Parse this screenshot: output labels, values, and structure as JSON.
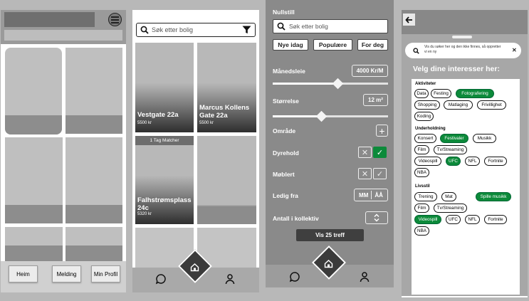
{
  "screen1": {
    "nav": {
      "home_label": "Heim",
      "messages_label": "Melding",
      "profile_label": "Min Profil"
    }
  },
  "screen2": {
    "search": {
      "placeholder": "Søk etter bolig"
    },
    "listings": [
      {
        "name": "Vestgate 22a",
        "price": "5500 kr",
        "badge": ""
      },
      {
        "name": "Marcus Kollens Gate 22a",
        "price": "5500 kr",
        "badge": ""
      },
      {
        "name": "Falhstrømsplass 24c",
        "price": "5320 kr",
        "badge": "1 Tag Matcher"
      }
    ]
  },
  "screen3": {
    "reset_label": "Nullstill",
    "search_placeholder": "Søk etter bolig",
    "quick_filters": [
      "Nye idag",
      "Populære",
      "For deg"
    ],
    "rent": {
      "label": "Månedsleie",
      "value": "4000 Kr/M",
      "fraction": 0.55
    },
    "size": {
      "label": "Størrelse",
      "value": "12 m²",
      "fraction": 0.4
    },
    "area": {
      "label": "Område"
    },
    "pets": {
      "label": "Dyrehold",
      "selected": "yes"
    },
    "furnished": {
      "label": "Møblert",
      "selected": "none"
    },
    "available": {
      "label": "Ledig fra",
      "month": "MM",
      "year": "ÅÅ"
    },
    "roommates": {
      "label": "Antall i kollektiv"
    },
    "submit_label": "Vis 25 treff"
  },
  "screen4": {
    "hint_text": "Vis du søker her og den ikke finnes, så oppretter vi en ny",
    "title": "Velg dine interesser her:",
    "categories": [
      {
        "name": "Aktiviteter",
        "tags": [
          {
            "label": "Data",
            "on": false
          },
          {
            "label": "Festing",
            "on": false
          },
          {
            "label": "Fotografering",
            "on": true
          },
          {
            "label": "Shopping",
            "on": false
          },
          {
            "label": "Matlaging",
            "on": false
          },
          {
            "label": "Frivillighet",
            "on": false
          },
          {
            "label": "Koding",
            "on": false
          }
        ]
      },
      {
        "name": "Underholdning",
        "tags": [
          {
            "label": "Konsert",
            "on": false
          },
          {
            "label": "Festivaler",
            "on": true
          },
          {
            "label": "Musikk",
            "on": false
          },
          {
            "label": "Film",
            "on": false
          },
          {
            "label": "Tv/Streaming",
            "on": false
          },
          {
            "label": "Videospill",
            "on": false
          },
          {
            "label": "UFC",
            "on": true
          },
          {
            "label": "NFL",
            "on": false
          },
          {
            "label": "Fortnite",
            "on": false
          },
          {
            "label": "NBA",
            "on": false
          }
        ]
      },
      {
        "name": "Livsstil",
        "tags": [
          {
            "label": "Trening",
            "on": false
          },
          {
            "label": "Mat",
            "on": false
          },
          {
            "label": "Spille musikk",
            "on": true
          },
          {
            "label": "Film",
            "on": false
          },
          {
            "label": "Tv/Streaming",
            "on": false
          },
          {
            "label": "Videospill",
            "on": true
          },
          {
            "label": "UFC",
            "on": false
          },
          {
            "label": "NFL",
            "on": false
          },
          {
            "label": "Fortnite",
            "on": false
          },
          {
            "label": "NBA",
            "on": false
          }
        ]
      }
    ]
  },
  "colors": {
    "selected_tag": "#0c8a3a",
    "check_active": "#0c8a3a"
  },
  "icons": [
    "hamburger-icon",
    "search-icon",
    "filter-icon",
    "chat-icon",
    "home-icon",
    "profile-icon",
    "plus-icon",
    "close-icon",
    "check-icon",
    "chevron-updown-icon",
    "back-arrow-icon"
  ]
}
